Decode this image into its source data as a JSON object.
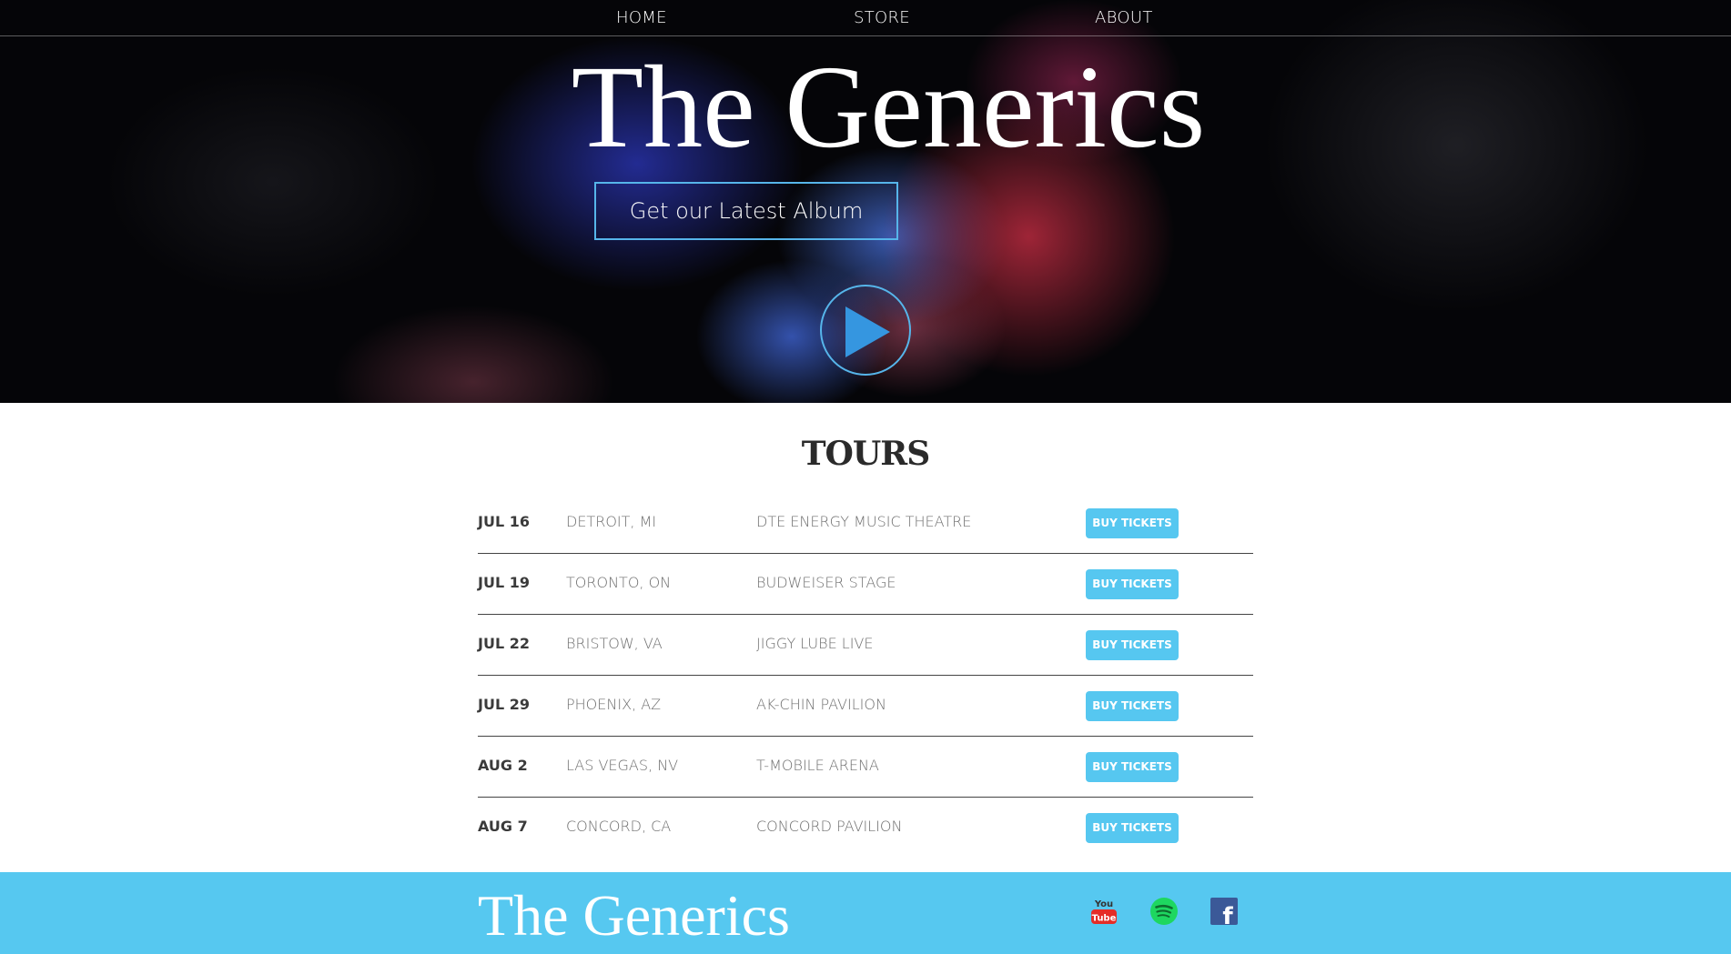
{
  "nav": {
    "home": "HOME",
    "store": "STORE",
    "about": "ABOUT"
  },
  "hero": {
    "title": "The Generics",
    "album_button": "Get our Latest Album",
    "play_icon": "play-icon"
  },
  "tours": {
    "heading": "TOURS",
    "button_label": "BUY TICKETS",
    "rows": [
      {
        "date": "JUL 16",
        "city": "DETROIT, MI",
        "venue": "DTE ENERGY MUSIC THEATRE"
      },
      {
        "date": "JUL 19",
        "city": "TORONTO, ON",
        "venue": "BUDWEISER STAGE"
      },
      {
        "date": "JUL 22",
        "city": "BRISTOW, VA",
        "venue": "JIGGY LUBE LIVE"
      },
      {
        "date": "JUL 29",
        "city": "PHOENIX, AZ",
        "venue": "AK-CHIN PAVILION"
      },
      {
        "date": "AUG 2",
        "city": "LAS VEGAS, NV",
        "venue": "T-MOBILE ARENA"
      },
      {
        "date": "AUG 7",
        "city": "CONCORD, CA",
        "venue": "CONCORD PAVILION"
      }
    ]
  },
  "footer": {
    "title": "The Generics",
    "social": [
      {
        "icon": "youtube-icon",
        "text_top": "You",
        "text_bottom": "Tube"
      },
      {
        "icon": "spotify-icon"
      },
      {
        "icon": "facebook-icon",
        "text": "f"
      }
    ]
  },
  "colors": {
    "accent": "#56c7f0",
    "button_border": "#56b5ea",
    "footer_bg": "#56c8f0",
    "youtube_red": "#e52d27",
    "spotify_green": "#1ed760",
    "facebook_blue": "#3b5998"
  }
}
